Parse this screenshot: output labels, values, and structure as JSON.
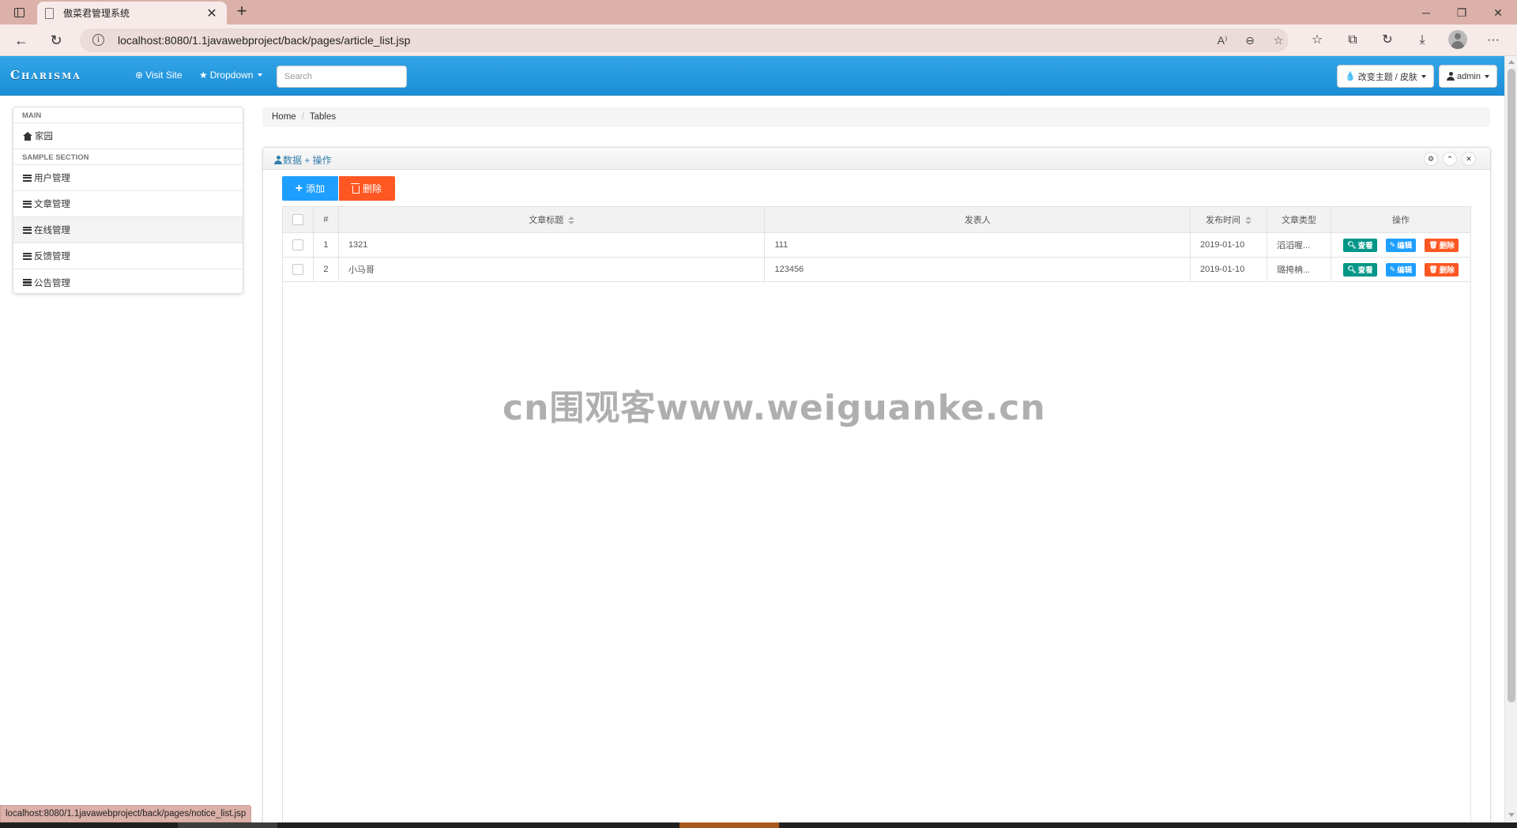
{
  "browser": {
    "tab_title": "傲菜君管理系统",
    "url": "localhost:8080/1.1javawebproject/back/pages/article_list.jsp",
    "status_url": "localhost:8080/1.1javawebproject/back/pages/notice_list.jsp",
    "tab_close_glyph": "✕",
    "new_tab_glyph": "+",
    "minimize_glyph": "─",
    "restore_glyph": "❐",
    "close_glyph": "✕",
    "read_aloud_glyph": "A⁾",
    "zoom_glyph": "⊖",
    "favorite_glyph": "☆",
    "favorites_glyph": "☆",
    "collections_glyph": "⧉",
    "history_glyph": "↻",
    "downloads_glyph": "⤓",
    "more_glyph": "···",
    "back_glyph": "←",
    "refresh_glyph": "↻",
    "info_glyph": "i"
  },
  "navbar": {
    "brand": "Charisma",
    "visit_site": "Visit Site",
    "dropdown": "Dropdown",
    "search_placeholder": "Search",
    "theme_button": "改变主题 / 皮肤",
    "user_button": "admin",
    "accent_color": "#2a9de2"
  },
  "sidebar": {
    "main_header": "MAIN",
    "home": "家园",
    "section_header": "SAMPLE SECTION",
    "items": [
      {
        "label": "用户管理"
      },
      {
        "label": "文章管理"
      },
      {
        "label": "在线管理"
      },
      {
        "label": "反馈管理"
      },
      {
        "label": "公告管理"
      }
    ]
  },
  "breadcrumb": {
    "home": "Home",
    "separator": "/",
    "current": "Tables"
  },
  "panel": {
    "title": "数据 + 操作",
    "tool_settings": "⚙",
    "tool_collapse": "⌃",
    "tool_close": "✕"
  },
  "toolbar": {
    "add_label": "添加",
    "delete_label": "删除",
    "add_color": "#1e9fff",
    "delete_color": "#ff5722"
  },
  "table": {
    "headers": {
      "index": "#",
      "title": "文章标题",
      "author": "发表人",
      "date": "发布时间",
      "type": "文章类型",
      "actions": "操作"
    },
    "rows": [
      {
        "index": "1",
        "title": "1321",
        "author": "111",
        "date": "2019-01-10",
        "type": "滔滔喔..."
      },
      {
        "index": "2",
        "title": "小马哥",
        "author": "123456",
        "date": "2019-01-10",
        "type": "璐挎柟..."
      }
    ],
    "view_label": "查看",
    "edit_label": "编辑",
    "remove_label": "删除"
  },
  "watermark": "cn围观客www.weiguanke.cn"
}
